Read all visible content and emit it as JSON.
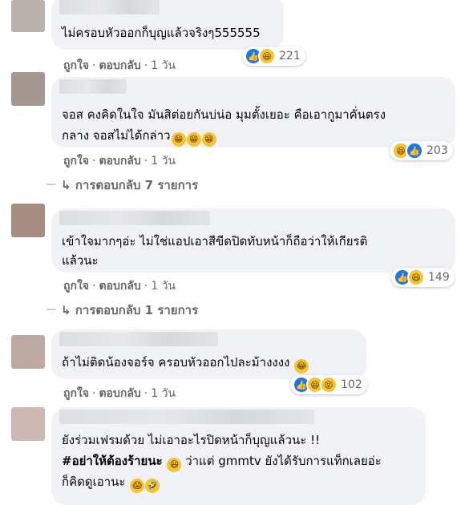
{
  "comments": [
    {
      "text_lines": [
        "ไม่ครอบหัวออกก็บุญแล้วจริงๆ555555"
      ],
      "actions": {
        "like": "ถูกใจ",
        "reply": "ตอบกลับ",
        "time": "1 วัน"
      },
      "reactions": {
        "icons": [
          "like-icon",
          "haha-icon"
        ],
        "count": "221"
      }
    },
    {
      "text_lines": [
        "จอส คงคิดในใจ มันสิต่อยกันบ่น่อ มุมตั้งเยอะ คือเอากูมาคั่นตรง",
        "กลาง จอสไม่ได้กล่าว"
      ],
      "inline_emojis": [
        "grin-emoji",
        "grin-emoji",
        "grin-emoji"
      ],
      "actions": {
        "like": "ถูกใจ",
        "reply": "ตอบกลับ",
        "time": "1 วัน"
      },
      "reactions": {
        "icons": [
          "haha-icon",
          "like-icon"
        ],
        "count": "203"
      },
      "replies": "การตอบกลับ 7 รายการ"
    },
    {
      "text_lines": [
        "เข้าใจมากๆอ่ะ ไม่ใช่แอปเอาสีขีดปิดทับหน้าก็ถือว่าให้เกียรติ",
        "แล้วนะ"
      ],
      "actions": {
        "like": "ถูกใจ",
        "reply": "ตอบกลับ",
        "time": "1 วัน"
      },
      "reactions": {
        "icons": [
          "like-icon",
          "haha-icon"
        ],
        "count": "149"
      },
      "replies": "การตอบกลับ 1 รายการ"
    },
    {
      "text_lines": [
        "ถ้าไม่ติดน้องจอร์จ ครอบหัวออกไปละม้างงงง"
      ],
      "inline_emojis": [
        "laugh-cry-emoji"
      ],
      "actions": {
        "like": "ถูกใจ",
        "reply": "ตอบกลับ",
        "time": "1 วัน"
      },
      "reactions": {
        "icons": [
          "like-icon",
          "haha-icon",
          "laugh-squint-icon"
        ],
        "count": "102"
      }
    },
    {
      "text_lines": [
        "ยังร่วมเฟรมด้วย ไม่เอาอะไรปิดหน้าก็บุญแล้วนะ !!"
      ],
      "hashtag": "#อย่าให้ต้องร้ายนะ",
      "line2_rest": " ว่าแต่ gmmtv ยังได้รับการแท็กเลยอ่ะ",
      "line3": "ก็คิดดูเอานะ"
    }
  ],
  "colors": {
    "bubble": "#f0f2f5",
    "muted": "#65676b",
    "like": "#1877f2",
    "haha": "#f7c32e"
  }
}
